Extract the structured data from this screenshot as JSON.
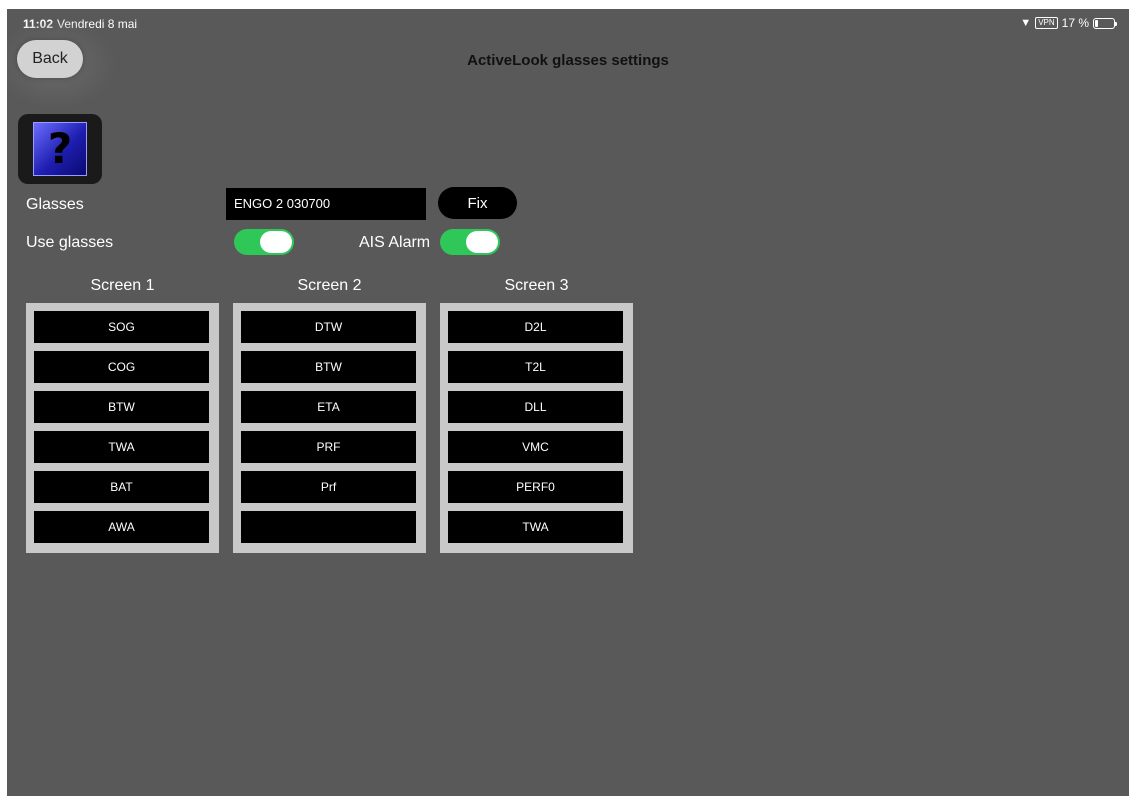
{
  "status": {
    "time": "11:02",
    "date": "Vendredi 8 mai",
    "vpn": "VPN",
    "battery": "17 %",
    "wifi_icon": "wifi-icon",
    "battery_level": 0.17
  },
  "nav": {
    "back_label": "Back",
    "title": "ActiveLook glasses settings"
  },
  "help": {
    "glyph": "?",
    "icon": "help-icon"
  },
  "settings": {
    "glasses_label": "Glasses",
    "glasses_value": "ENGO 2 030700",
    "fix_label": "Fix",
    "use_glasses_label": "Use glasses",
    "use_glasses_on": true,
    "ais_alarm_label": "AIS Alarm",
    "ais_alarm_on": true
  },
  "colors": {
    "background": "#595959",
    "toggle_on": "#30c759",
    "panel": "#c8c8c8"
  },
  "screens": [
    {
      "title": "Screen 1",
      "slots": [
        "SOG",
        "COG",
        "BTW",
        "TWA",
        "BAT",
        "AWA"
      ]
    },
    {
      "title": "Screen 2",
      "slots": [
        "DTW",
        "BTW",
        "ETA",
        "PRF",
        "Prf",
        ""
      ]
    },
    {
      "title": "Screen 3",
      "slots": [
        "D2L",
        "T2L",
        "DLL",
        "VMC",
        "PERF0",
        "TWA"
      ]
    }
  ]
}
